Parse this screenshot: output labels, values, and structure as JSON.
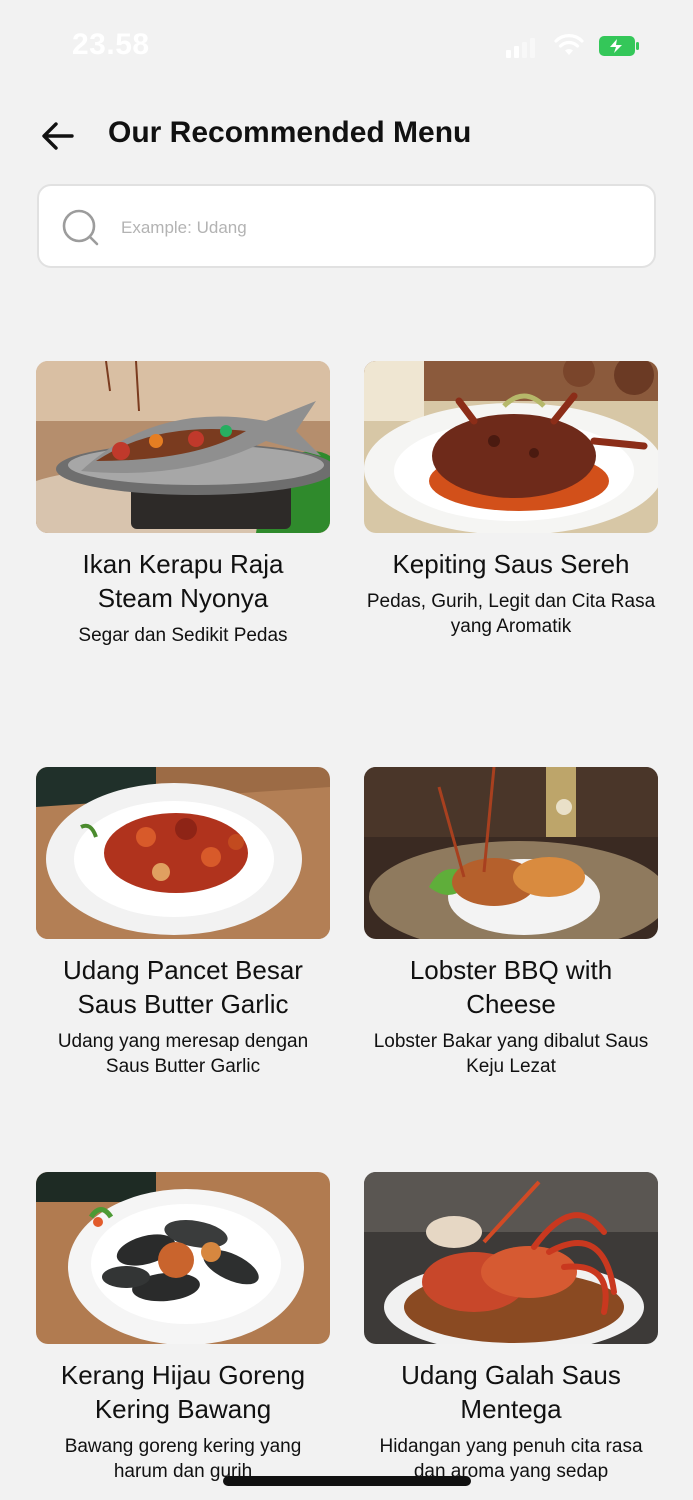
{
  "status_bar": {
    "time": "23.58",
    "icons": [
      "signal-icon",
      "wifi-icon",
      "battery-icon"
    ]
  },
  "header": {
    "back_icon": "arrow-left-icon",
    "title": "Our Recommended Menu"
  },
  "search": {
    "icon": "search-icon",
    "placeholder": "Example: Udang",
    "value": ""
  },
  "menu_items": [
    {
      "name": "Ikan Kerapu Raja Steam Nyonya",
      "description": "Segar dan Sedikit Pedas",
      "image": "steamed-grouper-photo"
    },
    {
      "name": "Kepiting Saus Sereh",
      "description": "Pedas, Gurih, Legit dan Cita Rasa yang Aromatik",
      "image": "crab-lemongrass-photo"
    },
    {
      "name": "Udang Pancet Besar Saus Butter Garlic",
      "description": "Udang yang meresap dengan Saus Butter Garlic",
      "image": "butter-garlic-prawn-photo"
    },
    {
      "name": "Lobster BBQ with Cheese",
      "description": "Lobster Bakar yang dibalut Saus Keju Lezat",
      "image": "bbq-lobster-photo"
    },
    {
      "name": "Kerang Hijau Goreng Kering Bawang",
      "description": "Bawang goreng kering yang harum dan gurih",
      "image": "green-mussels-photo"
    },
    {
      "name": "Udang Galah Saus Mentega",
      "description": "Hidangan yang penuh cita rasa dan aroma yang sedap",
      "image": "butter-river-prawn-photo"
    }
  ],
  "colors": {
    "background": "#f2f2f2",
    "battery_green": "#34c759",
    "text": "#111111",
    "placeholder": "#b3b3b3"
  }
}
